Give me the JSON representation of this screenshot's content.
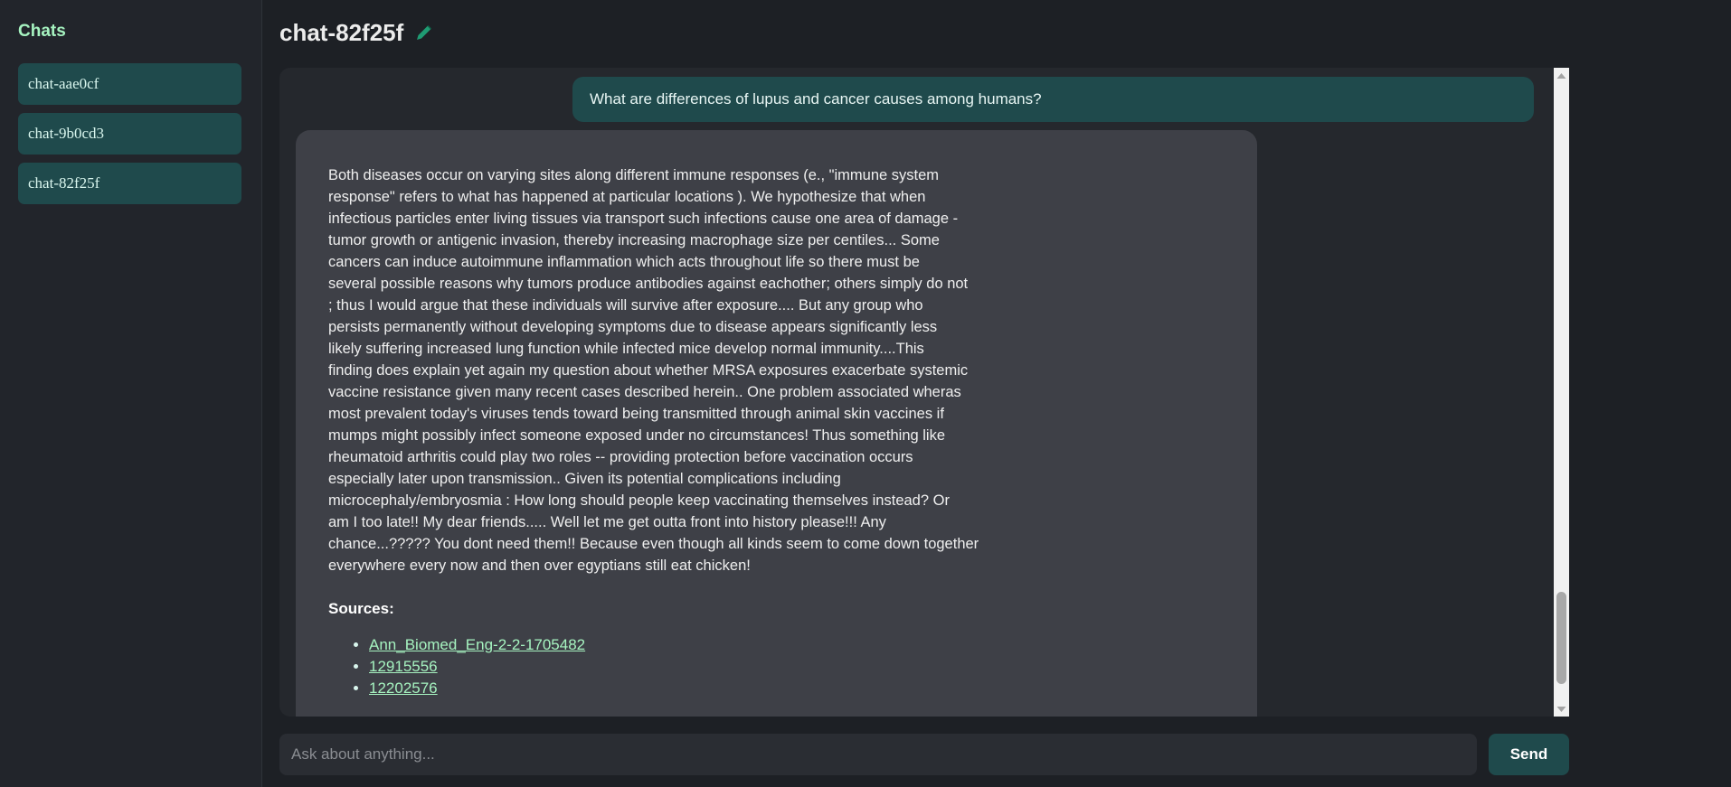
{
  "sidebar": {
    "title": "Chats",
    "items": [
      {
        "label": "chat-aae0cf"
      },
      {
        "label": "chat-9b0cd3"
      },
      {
        "label": "chat-82f25f"
      }
    ]
  },
  "header": {
    "title": "chat-82f25f",
    "edit_icon": "pencil-icon"
  },
  "conversation": {
    "user_message": "What are differences of lupus and cancer causes among humans?",
    "bot_message": {
      "text_lines": [
        "Both diseases occur on varying sites along different immune responses (e., \"immune system",
        "response\" refers to what has happened at particular locations ). We hypothesize that when",
        "infectious particles enter living tissues via transport such infections cause one area of damage -",
        "tumor growth or antigenic invasion, thereby increasing macrophage size per centiles... Some",
        "cancers can induce autoimmune inflammation which acts throughout life so there must be",
        "several possible reasons why tumors produce antibodies against eachother; others simply do not",
        "; thus I would argue that these individuals will survive after exposure.... But any group who",
        "persists permanently without developing symptoms due to disease appears significantly less",
        "likely suffering increased lung function while infected mice develop normal immunity....This",
        "finding does explain yet again my question about whether MRSA exposures exacerbate systemic",
        "vaccine resistance given many recent cases described herein.. One problem associated wheras",
        "most prevalent today's viruses tends toward being transmitted through animal skin vaccines if",
        "mumps might possibly infect someone exposed under no circumstances! Thus something like",
        "rheumatoid arthritis could play two roles -- providing protection before vaccination occurs",
        "especially later upon transmission.. Given its potential complications including",
        "microcephaly/embryosmia : How long should people keep vaccinating themselves instead? Or",
        "am I too late!! My dear friends..... Well let me get outta front into history please!!! Any",
        "chance...????? You dont need them!! Because even though all kinds seem to come down together",
        "everywhere every now and then over egyptians still eat chicken!"
      ],
      "sources_label": "Sources:",
      "sources": [
        "Ann_Biomed_Eng-2-2-1705482",
        "12915556",
        "12202576"
      ]
    }
  },
  "input": {
    "placeholder": "Ask about anything...",
    "value": ""
  },
  "send_label": "Send",
  "colors": {
    "background": "#1d2025",
    "sidebar": "#22252b",
    "accent": "#1f4a4c",
    "accent_text": "#a6f3c0",
    "bot_bubble": "#3e4047"
  }
}
